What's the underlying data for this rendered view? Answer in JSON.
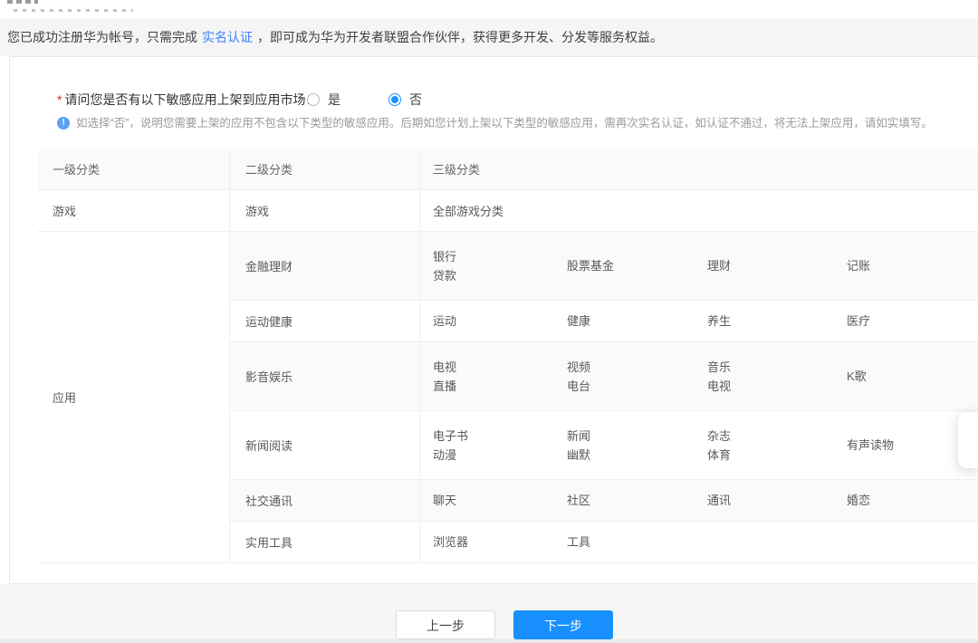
{
  "banner": {
    "pre": "您已成功注册华为帐号，只需完成",
    "link": "实名认证",
    "post": "，即可成为华为开发者联盟合作伙伴，获得更多开发、分发等服务权益。"
  },
  "question": {
    "required_mark": "*",
    "label": "请问您是否有以下敏感应用上架到应用市场：",
    "options": [
      {
        "label": "是",
        "selected": false
      },
      {
        "label": "否",
        "selected": true
      }
    ],
    "tip": "如选择“否”，说明您需要上架的应用不包含以下类型的敏感应用。后期如您计划上架以下类型的敏感应用，需再次实名认证，如认证不通过，将无法上架应用，请如实填写。"
  },
  "table": {
    "headers": [
      "一级分类",
      "二级分类",
      "三级分类"
    ],
    "game_row": {
      "level1": "游戏",
      "level2": "游戏",
      "level3": "全部游戏分类"
    },
    "app_group": {
      "level1": "应用",
      "rows": [
        {
          "level2": "金融理财",
          "cells": [
            [
              "银行",
              "贷款"
            ],
            [
              "股票基金"
            ],
            [
              "理财"
            ],
            [
              "记账"
            ]
          ]
        },
        {
          "level2": "运动健康",
          "cells": [
            [
              "运动"
            ],
            [
              "健康"
            ],
            [
              "养生"
            ],
            [
              "医疗"
            ]
          ]
        },
        {
          "level2": "影音娱乐",
          "cells": [
            [
              "电视",
              "直播"
            ],
            [
              "视频",
              "电台"
            ],
            [
              "音乐",
              "电视"
            ],
            [
              "K歌"
            ]
          ]
        },
        {
          "level2": "新闻阅读",
          "cells": [
            [
              "电子书",
              "动漫"
            ],
            [
              "新闻",
              "幽默"
            ],
            [
              "杂志",
              "体育"
            ],
            [
              "有声读物"
            ]
          ]
        },
        {
          "level2": "社交通讯",
          "cells": [
            [
              "聊天"
            ],
            [
              "社区"
            ],
            [
              "通讯"
            ],
            [
              "婚恋"
            ]
          ]
        },
        {
          "level2": "实用工具",
          "cells": [
            [
              "浏览器"
            ],
            [
              "工具"
            ]
          ]
        }
      ]
    }
  },
  "buttons": {
    "prev": "上一步",
    "next": "下一步"
  },
  "colors": {
    "accent_blue": "#1890ff",
    "link_blue": "#3d7eff",
    "required_red": "#e02020",
    "info_icon_blue": "#5ba0f2",
    "stripe_gray": "#fafafa",
    "banner_gray": "#f5f5f5"
  }
}
